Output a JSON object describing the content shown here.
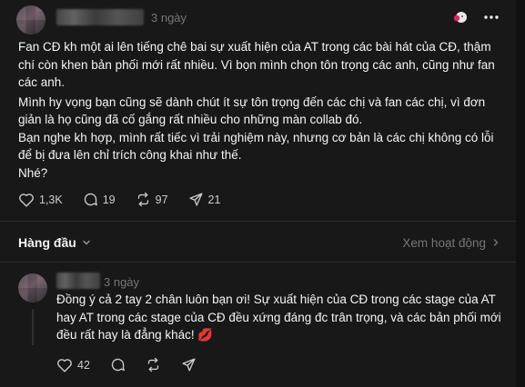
{
  "post": {
    "timestamp": "3 ngày",
    "paragraphs": [
      "Fan CĐ kh một ai lên tiếng chê bai sự xuất hiện của AT trong các bài hát của CĐ, thậm chí còn khen bản phối mới rất nhiều. Vì bọn mình chọn tôn trọng các anh, cũng như fan các anh.",
      "Mình hy vọng bạn cũng sẽ dành chút ít sự tôn trọng đến các chị và fan các chị, vì đơn giản là họ cũng đã cố gắng rất nhiều cho những màn collab đó.",
      "Bạn nghe kh hợp, mình rất tiếc vì trải nghiệm này, nhưng cơ bản là các chị không có lỗi để bị đưa lên chỉ trích công khai như thế.",
      "Nhé?"
    ],
    "likes": "1,3K",
    "replies": "19",
    "reposts": "97",
    "shares": "21",
    "more_icon": "more-horizontal-icon",
    "reaction_icon": "reaction-emoji-icon"
  },
  "sort": {
    "label": "Hàng đầu",
    "activity_link": "Xem hoạt động"
  },
  "reply": {
    "timestamp": "3 ngày",
    "text": "Đồng ý cả 2 tay 2 chân luôn bạn ơi! Sự xuất hiện của CĐ trong các stage của AT hay AT trong các stage của CĐ đều xứng đáng đc trân trọng, và các bản phối mới đều rất hay là đẳng khác! 💋",
    "likes": "42"
  },
  "colors": {
    "background": "#181818",
    "text": "#f3f5f7",
    "muted": "#777777",
    "divider": "#2d2d2d"
  }
}
